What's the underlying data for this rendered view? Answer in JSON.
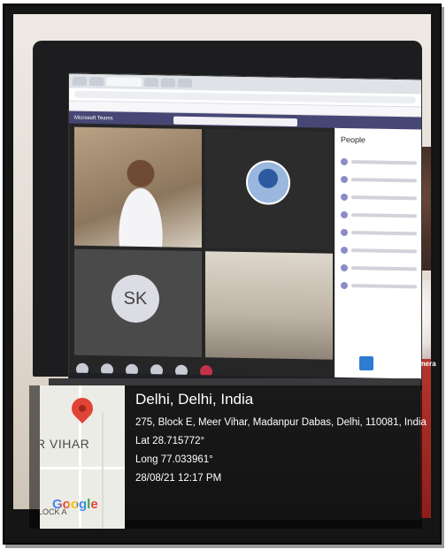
{
  "overlay": {
    "city": "Delhi, Delhi, India",
    "address": "275, Block E, Meer Vihar, Madanpur Dabas, Delhi, 110081, India",
    "lat": "Lat 28.715772°",
    "long": "Long 77.033961°",
    "datetime": "28/08/21 12:17 PM"
  },
  "gps_camera": {
    "label": "GPS Map Camera"
  },
  "map": {
    "area_label": "R VIHAR",
    "area_label2": "LOCK A",
    "brand": "Google"
  },
  "screen": {
    "app_title": "Microsoft Teams",
    "participant_initials": "SK",
    "panel_title": "People"
  },
  "colors": {
    "teams_bar": "#464775",
    "pin": "#e04436",
    "overlay_text": "#ffffff"
  }
}
